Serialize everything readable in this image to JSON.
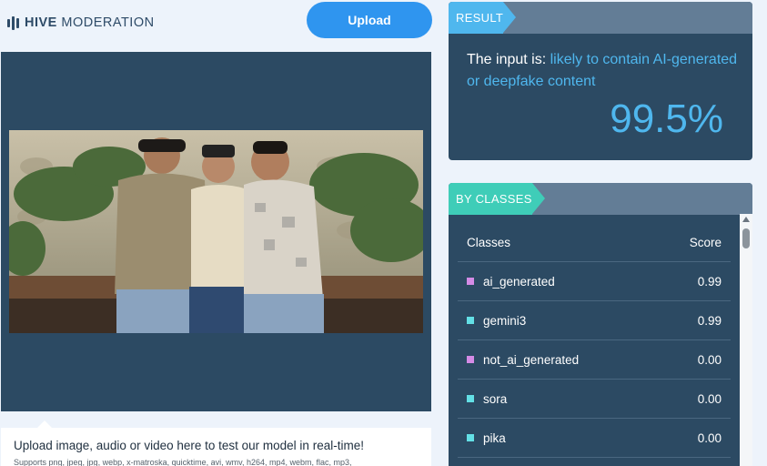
{
  "header": {
    "logo_bold": "HIVE",
    "logo_light": "MODERATION",
    "upload_label": "Upload"
  },
  "upload_panel": {
    "title": "Upload image, audio or video here to test our model in real-time!",
    "formats": "Supports png, jpeg, jpg, webp, x-matroska, quicktime, avi, wmv, h264, mp4, webm, flac, mp3,"
  },
  "result": {
    "tag": "RESULT",
    "prefix": "The input is: ",
    "verdict": "likely to contain AI-generated or deepfake content",
    "percent": "99.5%"
  },
  "classes": {
    "tag": "BY CLASSES",
    "col_class": "Classes",
    "col_score": "Score",
    "rows": [
      {
        "name": "ai_generated",
        "score": "0.99",
        "color": "#d48be6"
      },
      {
        "name": "gemini3",
        "score": "0.99",
        "color": "#63e0e6"
      },
      {
        "name": "not_ai_generated",
        "score": "0.00",
        "color": "#d48be6"
      },
      {
        "name": "sora",
        "score": "0.00",
        "color": "#63e0e6"
      },
      {
        "name": "pika",
        "score": "0.00",
        "color": "#63e0e6"
      }
    ]
  },
  "colors": {
    "brand_blue": "#2f95ef",
    "panel": "#2c4a63",
    "accent": "#4fb7ee",
    "classes_tag": "#3fcdb8"
  }
}
